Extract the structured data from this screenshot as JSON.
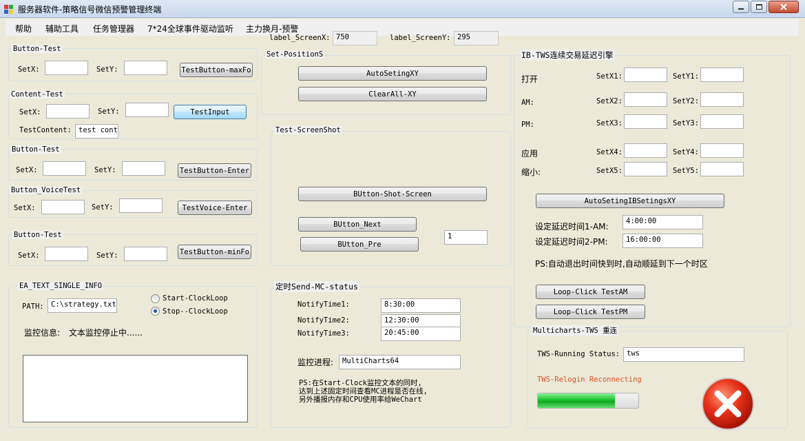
{
  "window": {
    "title": "服务器软件-策略信号微信预警管理终端"
  },
  "menu": [
    "帮助",
    "辅助工具",
    "任务管理器",
    "7*24全球事件驱动监听",
    "主力换月-预警"
  ],
  "screen": {
    "x_label": "label_ScreenX:",
    "x_value": "750",
    "y_label": "label_ScreenY:",
    "y_value": "295"
  },
  "left": {
    "g1": {
      "title": "Button-Test",
      "setx": "SetX:",
      "sety": "SetY:",
      "button": "TestButton-maxFo"
    },
    "g2": {
      "title": "Content-Test",
      "setx": "SetX:",
      "sety": "SetY:",
      "button": "TestInput",
      "content_label": "TestContent:",
      "content_value": "test conte"
    },
    "g3": {
      "title": "Button-Test",
      "setx": "SetX:",
      "sety": "SetY:",
      "button": "TestButton-Enter"
    },
    "g4": {
      "title": "Button_VoiceTest",
      "setx": "SetX:",
      "sety": "SetY:",
      "button": "TestVoice-Enter"
    },
    "g5": {
      "title": "Button-Test",
      "setx": "SetX:",
      "sety": "SetY:",
      "button": "TestButton-minFo"
    },
    "ea": {
      "title": "EA_TEXT_SINGLE_INFO",
      "path_label": "PATH:",
      "path_value": "C:\\strategy.txt",
      "radio1": "Start-ClockLoop",
      "radio2": "Stop--ClockLoop",
      "radio_selected": "Stop--ClockLoop",
      "monitor_label": "监控信息:",
      "monitor_value": "文本监控停止中......",
      "log": ""
    }
  },
  "mid": {
    "pos": {
      "title": "Set-PositionS",
      "auto": "AutoSetingXY",
      "clear": "ClearAll-XY"
    },
    "shot": {
      "title": "Test-ScreenShot",
      "shot_btn": "BUtton-Shot-Screen",
      "next_btn": "BUtton_Next",
      "pre_btn": "BUtton_Pre",
      "num_value": "1"
    },
    "notify": {
      "title": "定时Send-MC-status",
      "t1_label": "NotifyTime1:",
      "t1": "8:30:00",
      "t2_label": "NotifyTime2:",
      "t2": "12:30:00",
      "t3_label": "NotifyTime3:",
      "t3": "20:45:00",
      "proc_label": "监控进程:",
      "proc_value": "MultiCharts64",
      "ps_lines": [
        "PS:在Start-Clock监控文本的同时,",
        "达到上述固定时间查看MC进程是否在线,",
        "另外播报内存和CPU使用率给WeChart"
      ]
    }
  },
  "right": {
    "ib": {
      "title": "IB-TWS连续交易延迟引擎",
      "rows": [
        {
          "name": "打开",
          "x": "SetX1:",
          "y": "SetY1:"
        },
        {
          "name": "AM:",
          "x": "SetX2:",
          "y": "SetY2:"
        },
        {
          "name": "PM:",
          "x": "SetX3:",
          "y": "SetY3:"
        },
        {
          "name": "应用",
          "x": "SetX4:",
          "y": "SetY4:"
        },
        {
          "name": "缩小:",
          "x": "SetX5:",
          "y": "SetY5:"
        }
      ],
      "auto_btn": "AutoSetingIBSetingsXY",
      "delay1_label": "设定延迟时间1-AM:",
      "delay1": "4:00:00",
      "delay2_label": "设定延迟时间2-PM:",
      "delay2": "16:00:00",
      "ps": "PS:自动退出时间快到时,自动顺延到下一个时区",
      "loop_am": "Loop-Click TestAM",
      "loop_pm": "Loop-Click TestPM"
    },
    "mc": {
      "title": "Multicharts-TWS 重连",
      "status_label": "TWS-Running Status:",
      "status_value": "tws",
      "relogin": "TWS-Relogin Reconnecting",
      "progress": 0.77,
      "progress_color": "#19c42c",
      "relogin_color": "#e0502a"
    }
  }
}
